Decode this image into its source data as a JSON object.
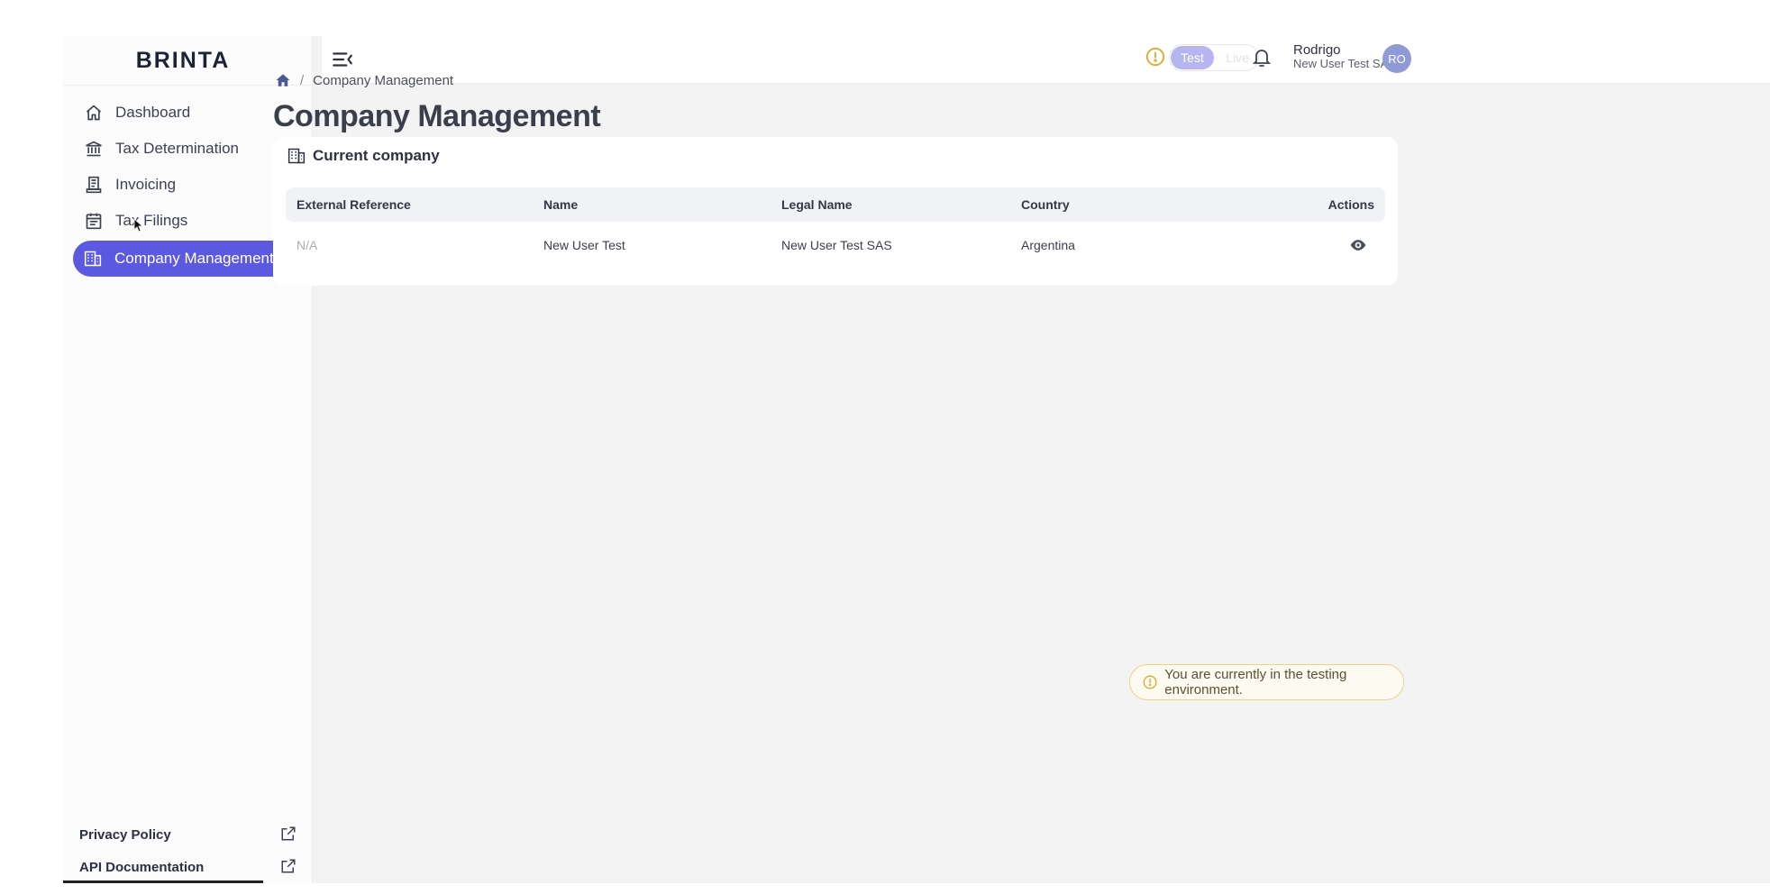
{
  "app": {
    "logo": "BRINTA"
  },
  "sidebar": {
    "items": [
      {
        "label": "Dashboard",
        "icon": "home-icon"
      },
      {
        "label": "Tax Determination",
        "icon": "bank-icon"
      },
      {
        "label": "Invoicing",
        "icon": "receipt-icon",
        "expandable": true
      },
      {
        "label": "Tax Filings",
        "icon": "calendar-list-icon",
        "expandable": true
      },
      {
        "label": "Company Management",
        "icon": "building-icon",
        "active": true
      }
    ],
    "footer": [
      {
        "label": "Privacy Policy",
        "icon": "external-link-icon"
      },
      {
        "label": "API Documentation",
        "icon": "external-link-icon"
      }
    ]
  },
  "topbar": {
    "environment": {
      "test_label": "Test",
      "live_label": "Live",
      "selected": "Test"
    },
    "user": {
      "name": "Rodrigo",
      "company": "New User Test SAS",
      "initials": "RO"
    }
  },
  "breadcrumb": {
    "current": "Company Management",
    "separator": "/"
  },
  "page": {
    "title": "Company Management"
  },
  "card": {
    "title": "Current company",
    "columns": [
      "External Reference",
      "Name",
      "Legal Name",
      "Country",
      "Actions"
    ],
    "rows": [
      {
        "external_reference": "N/A",
        "name": "New User Test",
        "legal_name": "New User Test SAS",
        "country": "Argentina"
      }
    ]
  },
  "toast": {
    "message": "You are currently in the testing environment."
  },
  "colors": {
    "accent": "#5b59e0",
    "warning": "#e0a82e",
    "avatar": "#8e9bd6"
  }
}
